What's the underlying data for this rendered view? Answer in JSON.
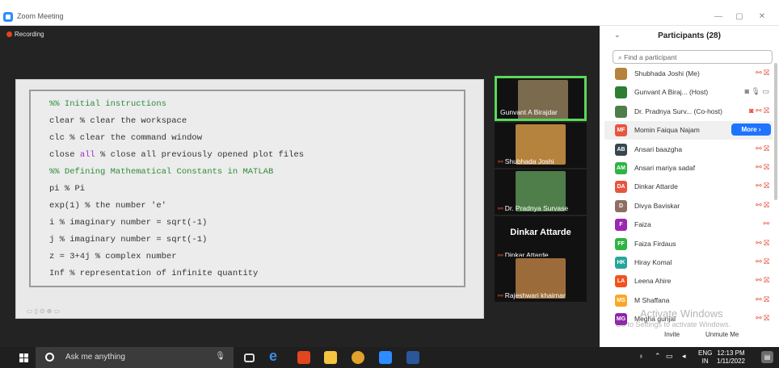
{
  "window": {
    "title": "Zoom Meeting"
  },
  "meeting": {
    "recording_label": "Recording"
  },
  "code_lines": [
    {
      "text": "%% Initial instructions",
      "cls": "c-green"
    },
    {
      "text": "clear % clear the workspace"
    },
    {
      "text": "clc % clear the command window"
    },
    {
      "text": "close all % close all previously opened plot files",
      "purple": "all"
    },
    {
      "text": "%% Defining Mathematical Constants in MATLAB",
      "cls": "c-green"
    },
    {
      "text": "pi % Pi"
    },
    {
      "text": "exp(1) % the number 'e'"
    },
    {
      "text": "i % imaginary number = sqrt(-1)"
    },
    {
      "text": "j % imaginary number = sqrt(-1)"
    },
    {
      "text": "z = 3+4j % complex number"
    },
    {
      "text": "Inf % representation of infinite quantity"
    }
  ],
  "tiles": [
    {
      "name": "Gunvant A Birajdar",
      "active": true,
      "photo": "#7a6a4e"
    },
    {
      "name": "Shubhada Joshi",
      "muted": true,
      "photo": "#b5833e"
    },
    {
      "name": "Dr. Pradnya Survase",
      "muted": true,
      "photo": "#4f7e4a"
    },
    {
      "name": "Dinkar Attarde",
      "muted": true,
      "big": "Dinkar Attarde"
    },
    {
      "name": "Rajeshwari khairnar",
      "muted": true,
      "photo": "#9b6c3a"
    }
  ],
  "participants": {
    "title": "Participants (28)",
    "search_placeholder": "Find a participant",
    "more_label": "More ›",
    "invite_label": "Invite",
    "unmute_me_label": "Unmute Me",
    "list": [
      {
        "initials": "",
        "name": "Shubhada Joshi (Me)",
        "color": "#b5833e",
        "icons": "⚯ ⛝"
      },
      {
        "initials": "",
        "name": "Gunvant A Biraj...  (Host)",
        "color": "#2e7d32",
        "icons": "◙ 🎙 ▭",
        "grey": true
      },
      {
        "initials": "",
        "name": "Dr. Pradnya Surv... (Co-host)",
        "color": "#4f7e4a",
        "icons": "◙ ⚯ ⛝"
      },
      {
        "initials": "MF",
        "name": "Momin Faiqua Najam",
        "color": "#e8553e",
        "more": true
      },
      {
        "initials": "AB",
        "name": "Ansari baazgha",
        "color": "#37474f",
        "icons": "⚯ ⛝"
      },
      {
        "initials": "AM",
        "name": "Ansari mariya sadaf",
        "color": "#2fb344",
        "icons": "⚯ ⛝"
      },
      {
        "initials": "DA",
        "name": "Dinkar Attarde",
        "color": "#e8553e",
        "icons": "⚯ ⛝"
      },
      {
        "initials": "D",
        "name": "Divya Baviskar",
        "color": "#8d6e63",
        "icons": "⚯ ⛝"
      },
      {
        "initials": "F",
        "name": "Faiza",
        "color": "#9c27b0",
        "icons": "⚯"
      },
      {
        "initials": "FF",
        "name": "Faiza Firdaus",
        "color": "#2fb344",
        "icons": "⚯ ⛝"
      },
      {
        "initials": "HK",
        "name": "Hiray Komal",
        "color": "#26a69a",
        "icons": "⚯ ⛝"
      },
      {
        "initials": "LA",
        "name": "Leena Ahire",
        "color": "#f4511e",
        "icons": "⚯ ⛝"
      },
      {
        "initials": "MS",
        "name": "M Shaffana",
        "color": "#f9a825",
        "icons": "⚯ ⛝"
      },
      {
        "initials": "MG",
        "name": "Megha gunjal",
        "color": "#8e24aa",
        "icons": "⚯ ⛝"
      }
    ],
    "watermark_title": "Activate Windows",
    "watermark_sub": "Go to Settings to activate Windows."
  },
  "taskbar": {
    "search_text": "Ask me anything",
    "lang_top": "ENG",
    "lang_bottom": "IN",
    "time": "12:13 PM",
    "date": "1/11/2022"
  }
}
